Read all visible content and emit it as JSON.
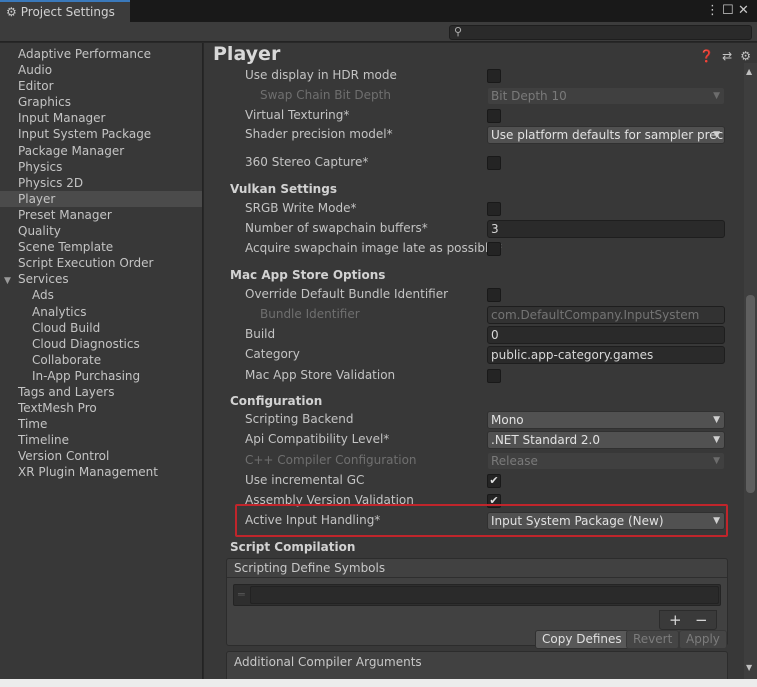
{
  "window": {
    "tab_title": "Project Settings",
    "menu_glyph": "⋮",
    "maximize_glyph": "☐",
    "close_glyph": "✕"
  },
  "search": {
    "value": "",
    "placeholder": ""
  },
  "sidebar": {
    "items": [
      {
        "label": "Adaptive Performance"
      },
      {
        "label": "Audio"
      },
      {
        "label": "Editor"
      },
      {
        "label": "Graphics"
      },
      {
        "label": "Input Manager"
      },
      {
        "label": "Input System Package"
      },
      {
        "label": "Package Manager"
      },
      {
        "label": "Physics"
      },
      {
        "label": "Physics 2D"
      },
      {
        "label": "Player"
      },
      {
        "label": "Preset Manager"
      },
      {
        "label": "Quality"
      },
      {
        "label": "Scene Template"
      },
      {
        "label": "Script Execution Order"
      },
      {
        "label": "Services"
      },
      {
        "label": "Ads"
      },
      {
        "label": "Analytics"
      },
      {
        "label": "Cloud Build"
      },
      {
        "label": "Cloud Diagnostics"
      },
      {
        "label": "Collaborate"
      },
      {
        "label": "In-App Purchasing"
      },
      {
        "label": "Tags and Layers"
      },
      {
        "label": "TextMesh Pro"
      },
      {
        "label": "Time"
      },
      {
        "label": "Timeline"
      },
      {
        "label": "Version Control"
      },
      {
        "label": "XR Plugin Management"
      }
    ],
    "selected": "Player"
  },
  "main": {
    "title": "Player",
    "rows": {
      "hdr_display": {
        "label": "Use display in HDR mode",
        "checked": false
      },
      "swap_chain": {
        "label": "Swap Chain Bit Depth",
        "value": "Bit Depth 10"
      },
      "virtual_texturing": {
        "label": "Virtual Texturing*",
        "checked": false
      },
      "shader_precision": {
        "label": "Shader precision model*",
        "value": "Use platform defaults for sampler preci"
      },
      "stereo_capture": {
        "label": "360 Stereo Capture*",
        "checked": false
      },
      "srgb_write": {
        "label": "SRGB Write Mode*",
        "checked": false
      },
      "swapchain_buffers": {
        "label": "Number of swapchain buffers*",
        "value": "3"
      },
      "acquire_late": {
        "label": "Acquire swapchain image late as possible*",
        "checked": false
      },
      "override_bundle": {
        "label": "Override Default Bundle Identifier",
        "checked": false
      },
      "bundle_id": {
        "label": "Bundle Identifier",
        "value": "com.DefaultCompany.InputSystem"
      },
      "build": {
        "label": "Build",
        "value": "0"
      },
      "category": {
        "label": "Category",
        "value": "public.app-category.games"
      },
      "mas_validation": {
        "label": "Mac App Store Validation",
        "checked": false
      },
      "scripting_backend": {
        "label": "Scripting Backend",
        "value": "Mono"
      },
      "api_level": {
        "label": "Api Compatibility Level*",
        "value": ".NET Standard 2.0"
      },
      "cpp_config": {
        "label": "C++ Compiler Configuration",
        "value": "Release"
      },
      "incremental_gc": {
        "label": "Use incremental GC",
        "checked": true
      },
      "assembly_validation": {
        "label": "Assembly Version Validation",
        "checked": true
      },
      "active_input": {
        "label": "Active Input Handling*",
        "value": "Input System Package (New)"
      }
    },
    "sections": {
      "vulkan": "Vulkan Settings",
      "mac_app_store": "Mac App Store Options",
      "configuration": "Configuration",
      "script_compilation": "Script Compilation"
    },
    "script_compilation": {
      "define_symbols_label": "Scripting Define Symbols",
      "plus": "+",
      "minus": "−",
      "copy_defines": "Copy Defines",
      "revert": "Revert",
      "apply": "Apply"
    },
    "additional_compiler_args": "Additional Compiler Arguments"
  }
}
